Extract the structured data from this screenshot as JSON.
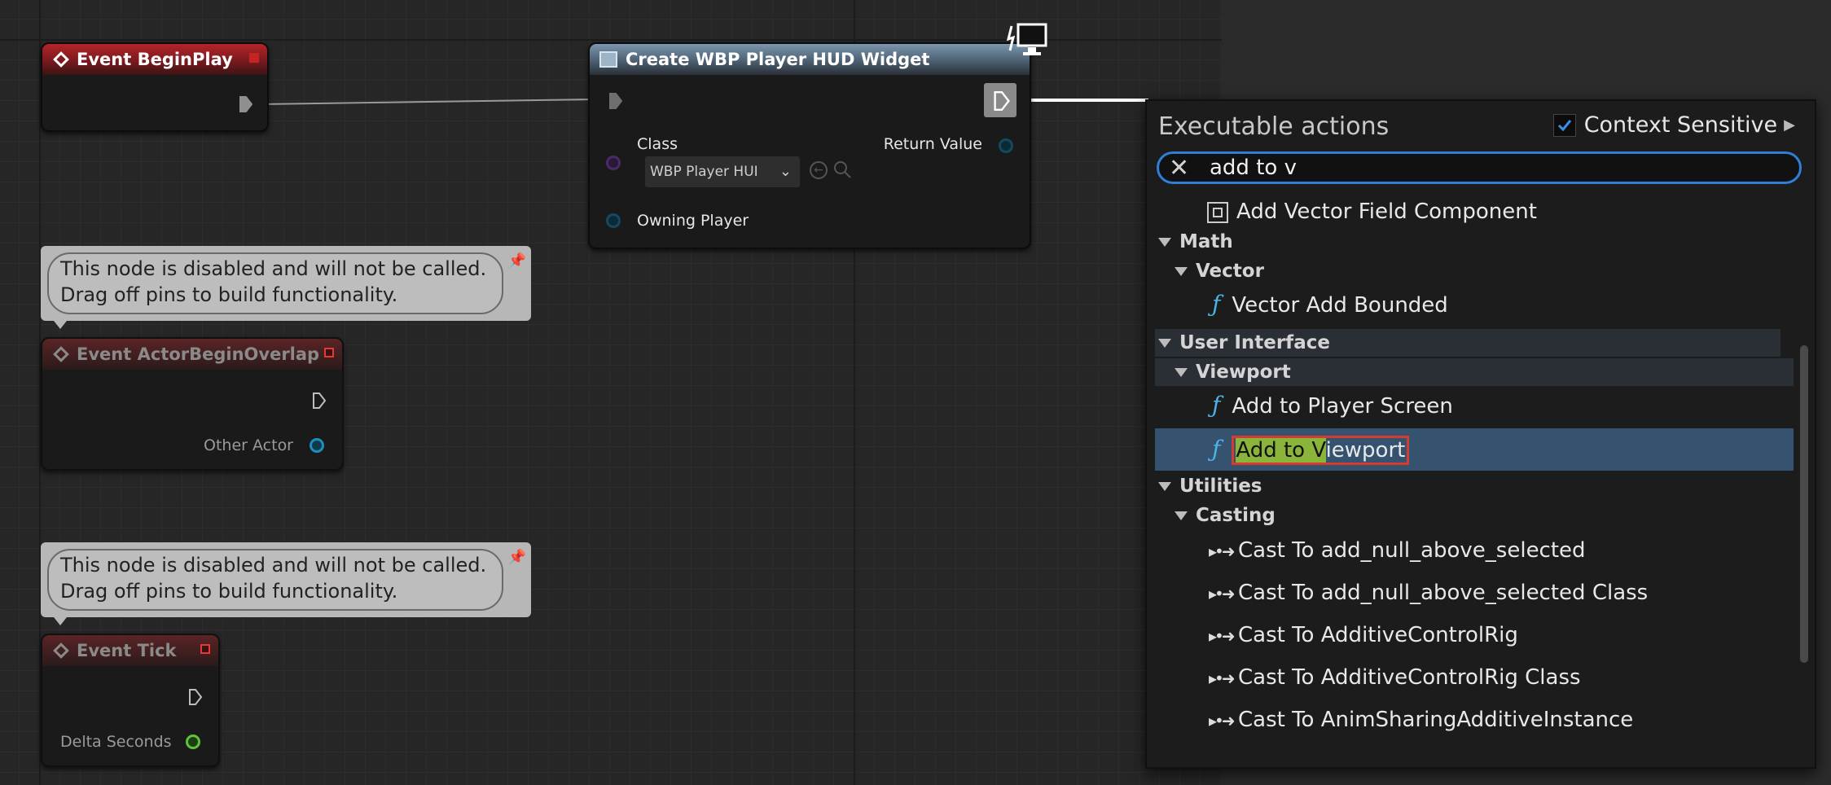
{
  "nodes": {
    "begin_play": {
      "title": "Event BeginPlay"
    },
    "create_widget": {
      "title": "Create WBP Player HUD Widget",
      "class_label": "Class",
      "class_value": "WBP Player HUI",
      "return_label": "Return Value",
      "owning_label": "Owning Player"
    },
    "comment1": {
      "line1": "This node is disabled and will not be called.",
      "line2": "Drag off pins to build functionality."
    },
    "actor_overlap": {
      "title": "Event ActorBeginOverlap",
      "pin": "Other Actor"
    },
    "comment2": {
      "line1": "This node is disabled and will not be called.",
      "line2": "Drag off pins to build functionality."
    },
    "tick": {
      "title": "Event Tick",
      "pin": "Delta Seconds"
    }
  },
  "menu": {
    "title": "Executable actions",
    "context_sensitive": "Context Sensitive",
    "search_value": "add to v",
    "items": {
      "vector_field": "Add Vector Field Component",
      "cat_math": "Math",
      "cat_vector": "Vector",
      "vector_add_bounded": "Vector Add Bounded",
      "cat_ui": "User Interface",
      "cat_viewport": "Viewport",
      "add_player_screen": "Add to Player Screen",
      "add_viewport_hl": "Add to V",
      "add_viewport_rest": "iewport",
      "cat_utilities": "Utilities",
      "cat_casting": "Casting",
      "cast1": "Cast To add_null_above_selected",
      "cast2": "Cast To add_null_above_selected Class",
      "cast3": "Cast To AdditiveControlRig",
      "cast4": "Cast To AdditiveControlRig Class",
      "cast5": "Cast To AnimSharingAdditiveInstance"
    },
    "fn_glyph": "ƒ"
  }
}
